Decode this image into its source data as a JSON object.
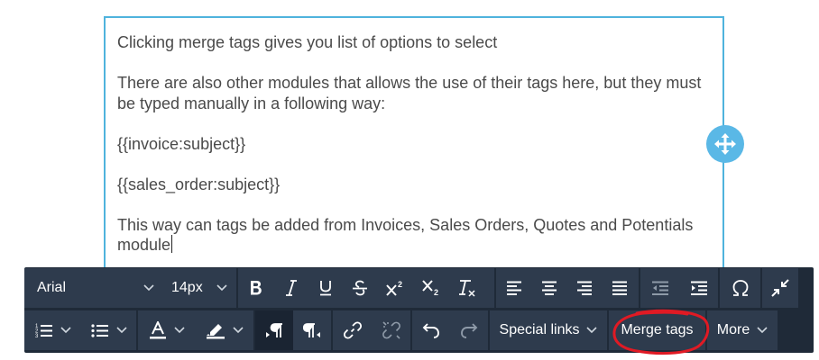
{
  "editor": {
    "paragraphs": [
      "Clicking merge tags gives you list of options to select",
      "There are also other modules that allows the use of their tags here, but they must be typed manually in a following way:",
      "{{invoice:subject}}",
      "{{sales_order:subject}}",
      "This way can tags be added from Invoices, Sales Orders, Quotes and Potentials module"
    ]
  },
  "toolbar": {
    "font_family": "Arial",
    "font_size": "14px",
    "special_links_label": "Special links",
    "merge_tags_label": "Merge tags",
    "more_label": "More"
  },
  "colors": {
    "toolbar_bg": "#1f2a38",
    "group_bg": "#2e3b4d",
    "editor_border": "#4fb3dd",
    "move_handle": "#5ab8e6",
    "annotation": "#e01a24"
  },
  "icons": [
    "move-icon",
    "chevron-down-icon",
    "bold-icon",
    "italic-icon",
    "underline-icon",
    "strikethrough-icon",
    "superscript-icon",
    "subscript-icon",
    "clear-formatting-icon",
    "align-left-icon",
    "align-center-icon",
    "align-right-icon",
    "align-justify-icon",
    "outdent-icon",
    "indent-icon",
    "omega-icon",
    "collapse-icon",
    "ordered-list-icon",
    "unordered-list-icon",
    "text-color-icon",
    "highlight-color-icon",
    "ltr-icon",
    "rtl-icon",
    "link-icon",
    "unlink-icon",
    "undo-icon",
    "redo-icon"
  ]
}
